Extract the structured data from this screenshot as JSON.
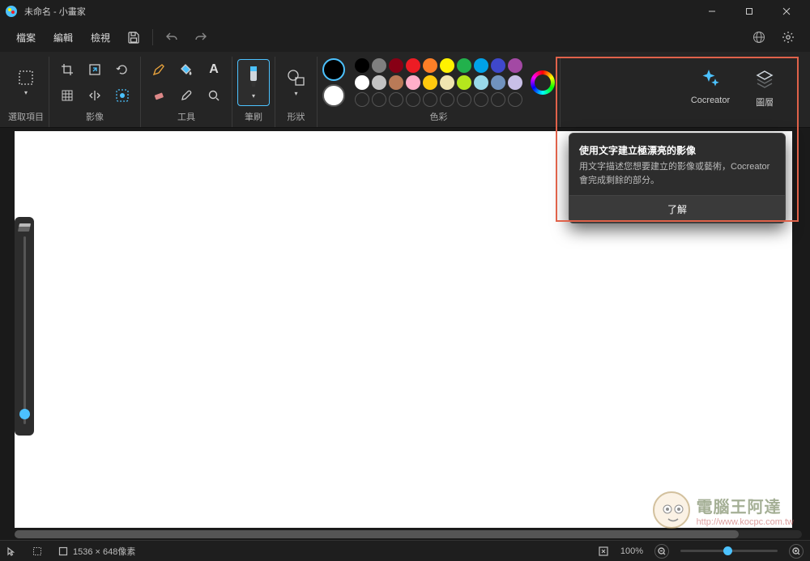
{
  "title": "未命名 - 小畫家",
  "menu": {
    "file": "檔案",
    "edit": "編輯",
    "view": "檢視"
  },
  "groups": {
    "selection": "選取項目",
    "image": "影像",
    "tools": "工具",
    "brushes": "筆刷",
    "shapes": "形狀",
    "colors": "色彩"
  },
  "side": {
    "cocreator": "Cocreator",
    "layers": "圖層"
  },
  "tooltip": {
    "title": "使用文字建立極漂亮的影像",
    "body": "用文字描述您想要建立的影像或藝術，Cocreator 會完成剩餘的部分。",
    "ok": "了解"
  },
  "status": {
    "dimensions": "1536 × 648像素",
    "zoom": "100%"
  },
  "colors_primary": "#000000",
  "colors_secondary": "#ffffff",
  "palette_row1": [
    "#000000",
    "#7f7f7f",
    "#880015",
    "#ed1c24",
    "#ff7f27",
    "#fff200",
    "#22b14c",
    "#00a2e8",
    "#3f48cc",
    "#a349a4"
  ],
  "palette_row2": [
    "#ffffff",
    "#c3c3c3",
    "#b97a57",
    "#ffaec9",
    "#ffc90e",
    "#efe4b0",
    "#b5e61d",
    "#99d9ea",
    "#7092be",
    "#c8bfe7"
  ],
  "watermark": {
    "line1": "電腦王阿達",
    "line2": "http://www.kocpc.com.tw"
  }
}
